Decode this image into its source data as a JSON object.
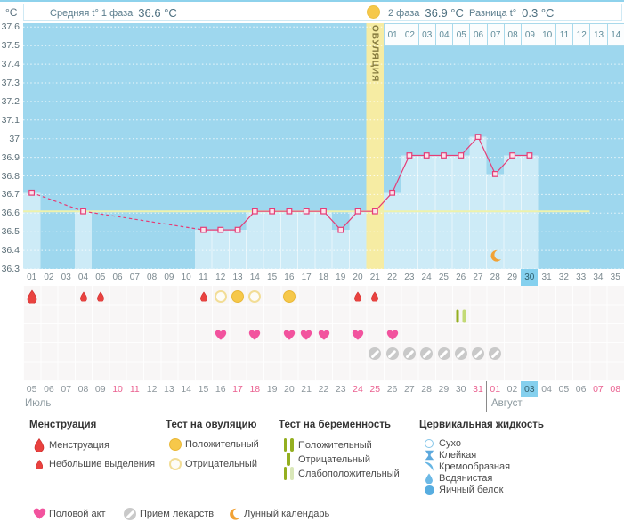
{
  "header": {
    "unit": "°C",
    "avg_phase1_label": "Средняя t° 1 фаза",
    "avg_phase1_value": "36.6 °C",
    "phase2_label": "2 фаза",
    "phase2_value": "36.9 °C",
    "diff_label": "Разница t°",
    "diff_value": "0.3 °C",
    "ovulation_label": "ОВУЛЯЦИЯ"
  },
  "colors": {
    "plot_bg": "#9ed7ee",
    "plot_fill": "#cdebf7",
    "ovulation_band": "#f6eca3",
    "coverline": "#eef2ab",
    "temp_line": "#e53d77",
    "marker_fill": "#fbe3ec",
    "today_highlight": "#85d0ee",
    "weekend_date": "#ea5f8f",
    "menstruation_red": "#e9423f",
    "ovulation_test_yellow": "#f6c84a",
    "pregnancy_test_green": "#94af20",
    "heart_pink": "#f2539e",
    "medication_gray": "#c9c9c9",
    "moon_orange": "#f1a236",
    "cervical_blue": "#6cb9e6"
  },
  "chart_data": {
    "type": "line",
    "title": "Basal body temperature cycle chart",
    "ylabel": "°C",
    "ylim": [
      36.3,
      37.6
    ],
    "yticks": [
      "37.6",
      "37.5",
      "37.4",
      "37.3",
      "37.2",
      "37.1",
      "37",
      "36.9",
      "36.8",
      "36.7",
      "36.6",
      "36.5",
      "36.4",
      "36.3"
    ],
    "x_days": [
      1,
      2,
      3,
      4,
      5,
      6,
      7,
      8,
      9,
      10,
      11,
      12,
      13,
      14,
      15,
      16,
      17,
      18,
      19,
      20,
      21,
      22,
      23,
      24,
      25,
      26,
      27,
      28,
      29,
      30,
      31,
      32,
      33,
      34,
      35
    ],
    "day_labels": [
      "01",
      "02",
      "03",
      "04",
      "05",
      "06",
      "07",
      "08",
      "09",
      "10",
      "11",
      "12",
      "13",
      "14",
      "15",
      "16",
      "17",
      "18",
      "19",
      "20",
      "21",
      "22",
      "23",
      "24",
      "25",
      "26",
      "27",
      "28",
      "29",
      "30",
      "31",
      "32",
      "33",
      "34",
      "35"
    ],
    "temperatures": [
      36.71,
      null,
      null,
      36.61,
      null,
      null,
      null,
      null,
      null,
      null,
      36.51,
      36.51,
      36.51,
      36.61,
      36.61,
      36.61,
      36.61,
      36.61,
      36.51,
      36.61,
      36.61,
      36.71,
      36.91,
      36.91,
      36.91,
      36.91,
      37.01,
      36.81,
      36.91,
      36.91,
      null,
      null,
      null,
      null,
      null
    ],
    "coverline": 36.61,
    "coverline_end_day": 33,
    "ovulation_day": 21,
    "today_day": 30,
    "grid": "dotted-horizontal",
    "dpo_labels": [
      "01",
      "02",
      "03",
      "04",
      "05",
      "06",
      "07",
      "08",
      "09",
      "10",
      "11",
      "12",
      "13",
      "14"
    ],
    "lunar_marker_day": 28
  },
  "events": {
    "menstruation": [
      {
        "day": 1,
        "size": "large"
      },
      {
        "day": 4,
        "size": "small"
      },
      {
        "day": 5,
        "size": "small"
      },
      {
        "day": 11,
        "size": "small"
      },
      {
        "day": 20,
        "size": "small"
      },
      {
        "day": 21,
        "size": "small"
      }
    ],
    "ovulation_tests": [
      {
        "day": 12,
        "result": "negative"
      },
      {
        "day": 13,
        "result": "positive"
      },
      {
        "day": 14,
        "result": "negative"
      },
      {
        "day": 16,
        "result": "positive"
      }
    ],
    "pregnancy_tests": [
      {
        "day": 26,
        "result": "weak_positive"
      }
    ],
    "intercourse_days": [
      12,
      14,
      16,
      17,
      18,
      20,
      22
    ],
    "medication_days": [
      21,
      22,
      23,
      24,
      25,
      26,
      27,
      28
    ]
  },
  "dates": {
    "labels": [
      "05",
      "06",
      "07",
      "08",
      "09",
      "10",
      "11",
      "12",
      "13",
      "14",
      "15",
      "16",
      "17",
      "18",
      "19",
      "20",
      "21",
      "22",
      "23",
      "24",
      "25",
      "26",
      "27",
      "28",
      "29",
      "30",
      "31",
      "01",
      "02",
      "03",
      "04",
      "05",
      "06",
      "07",
      "08"
    ],
    "weekend_days": [
      6,
      7,
      13,
      14,
      20,
      21,
      27,
      28,
      34,
      35
    ],
    "today_day": 30,
    "months": [
      {
        "name": "Июль",
        "start_day": 1
      },
      {
        "name": "Август",
        "start_day": 28
      }
    ]
  },
  "legend": {
    "sections": [
      {
        "title": "Менструация",
        "items": [
          {
            "icon": "drop-large",
            "label": "Менструация"
          },
          {
            "icon": "drop-small",
            "label": "Небольшие выделения"
          }
        ]
      },
      {
        "title": "Тест на овуляцию",
        "items": [
          {
            "icon": "circle-filled",
            "label": "Положительный"
          },
          {
            "icon": "circle-outline",
            "label": "Отрицательный"
          }
        ]
      },
      {
        "title": "Тест на беременность",
        "items": [
          {
            "icon": "bars-positive",
            "label": "Положительный"
          },
          {
            "icon": "bar-negative",
            "label": "Отрицательный"
          },
          {
            "icon": "bars-weak",
            "label": "Слабоположительный"
          }
        ]
      },
      {
        "title": "Цервикальная жидкость",
        "items": [
          {
            "icon": "cf-dry",
            "label": "Сухо"
          },
          {
            "icon": "cf-sticky",
            "label": "Клейкая"
          },
          {
            "icon": "cf-creamy",
            "label": "Кремообразная"
          },
          {
            "icon": "cf-watery",
            "label": "Водянистая"
          },
          {
            "icon": "cf-eggwhite",
            "label": "Яичный белок"
          }
        ]
      }
    ],
    "footer": [
      {
        "icon": "heart",
        "label": "Половой акт"
      },
      {
        "icon": "pill",
        "label": "Прием лекарств"
      },
      {
        "icon": "moon",
        "label": "Лунный календарь"
      }
    ]
  }
}
